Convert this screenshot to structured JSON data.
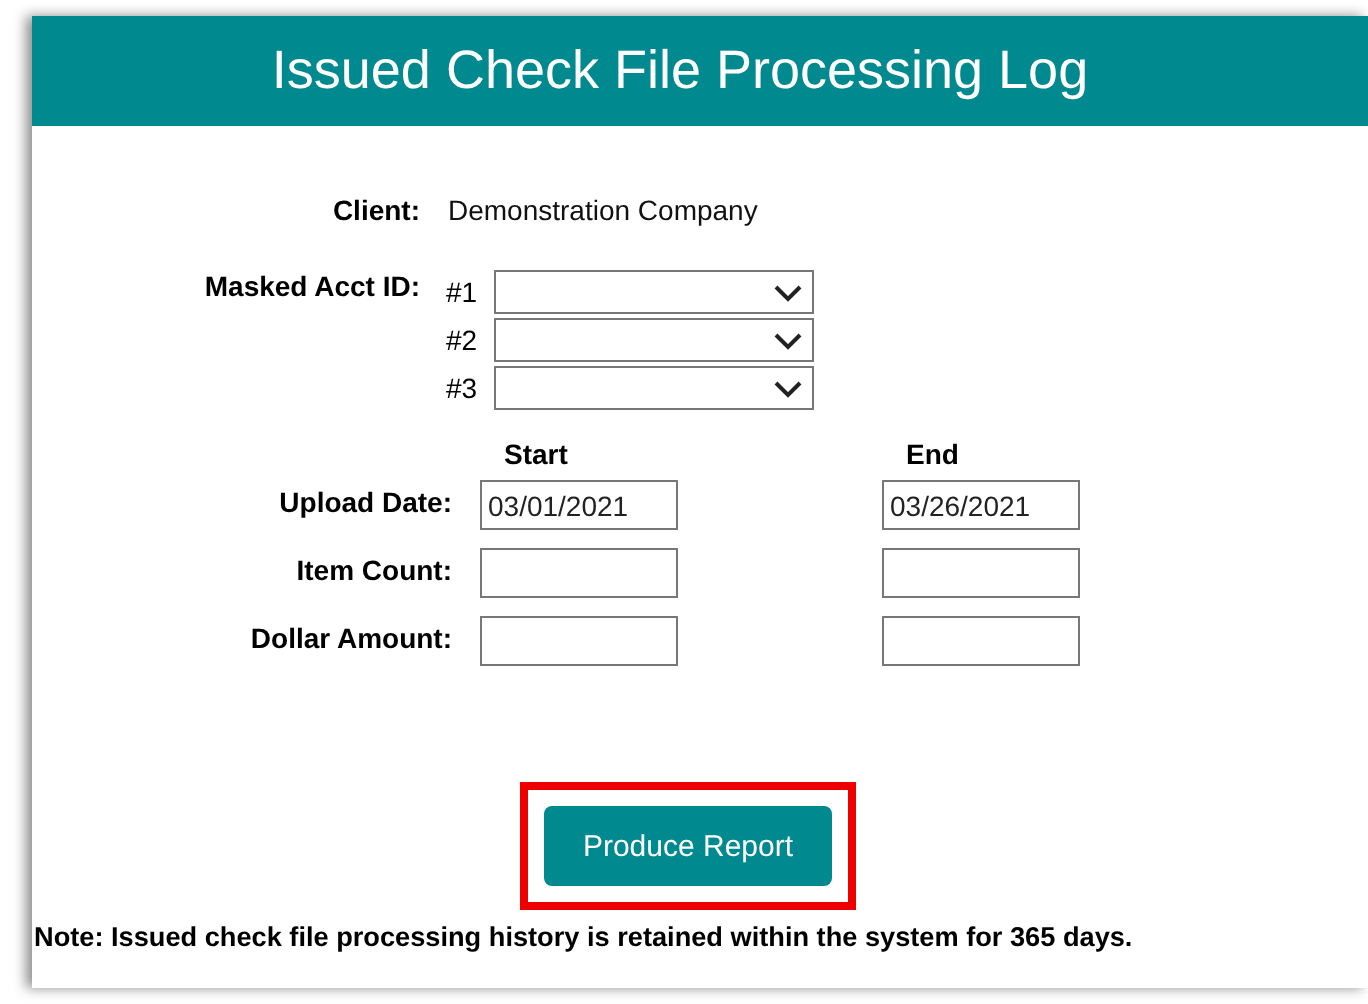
{
  "header": {
    "title": "Issued Check File Processing Log"
  },
  "client": {
    "label": "Client:",
    "value": "Demonstration Company"
  },
  "masked_acct": {
    "label": "Masked Acct ID:",
    "selects": [
      {
        "label": "#1"
      },
      {
        "label": "#2"
      },
      {
        "label": "#3"
      }
    ]
  },
  "range_headers": {
    "start": "Start",
    "end": "End"
  },
  "ranges": [
    {
      "label": "Upload Date:",
      "start": "03/01/2021",
      "end": "03/26/2021"
    },
    {
      "label": "Item Count:"
    },
    {
      "label": "Dollar Amount:"
    }
  ],
  "produce_button": {
    "label": "Produce Report",
    "highlighted": true
  },
  "note": "Note: Issued check file processing history is retained within the system for 365 days."
}
